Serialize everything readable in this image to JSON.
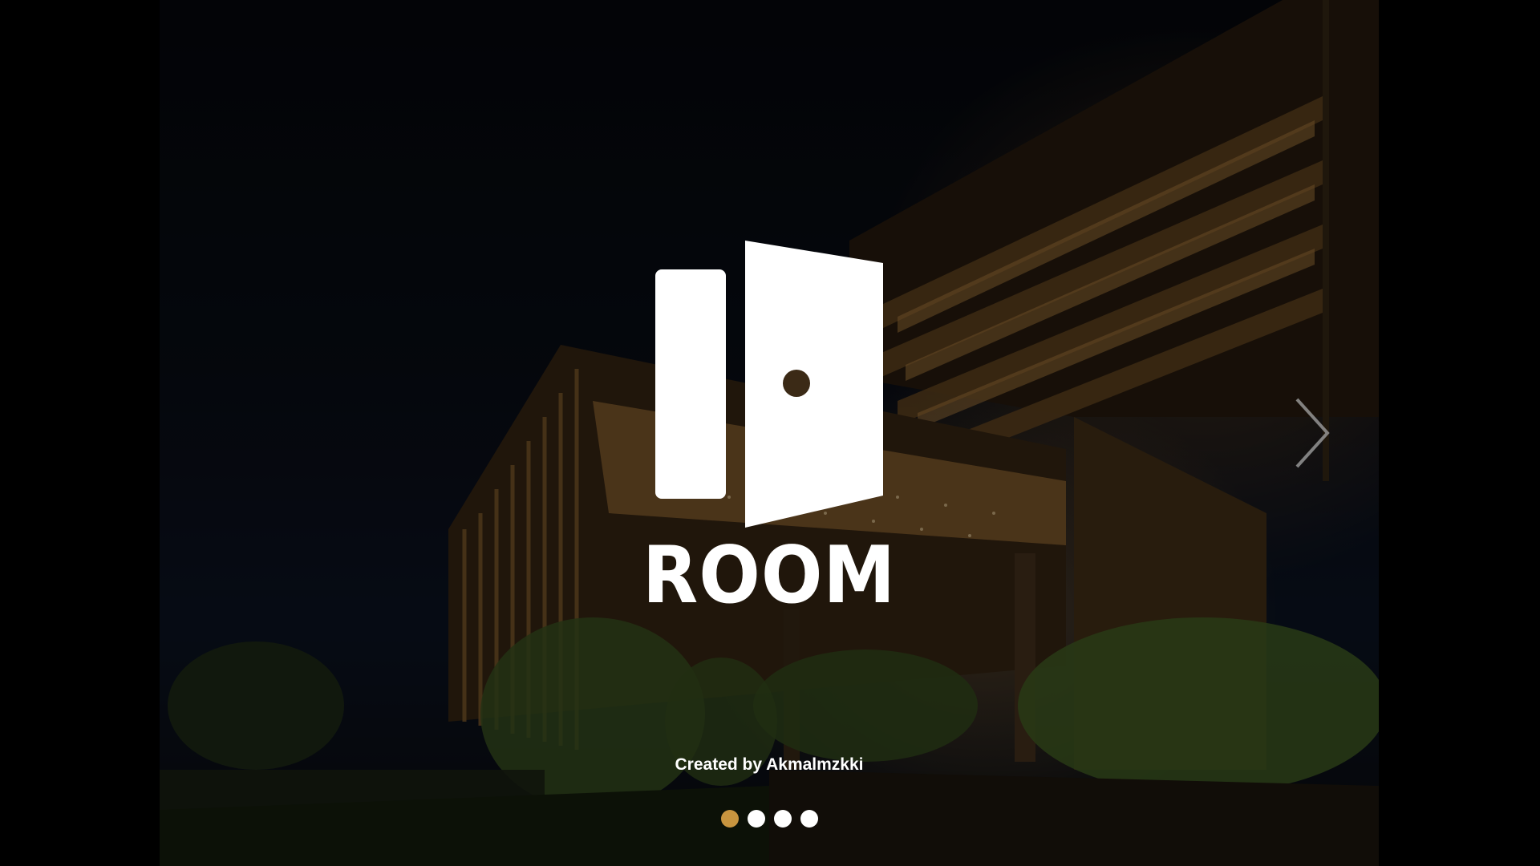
{
  "brand": {
    "name": "ROOM",
    "logo_icon": "door-icon"
  },
  "credit": {
    "text": "Created by Akmalmzkki"
  },
  "navigation": {
    "next_icon": "chevron-right-icon"
  },
  "pagination": {
    "count": 4,
    "active_index": 0
  },
  "colors": {
    "background": "#000000",
    "text": "#ffffff",
    "active_dot": "#c8953f",
    "inactive_dot": "#ffffff"
  }
}
